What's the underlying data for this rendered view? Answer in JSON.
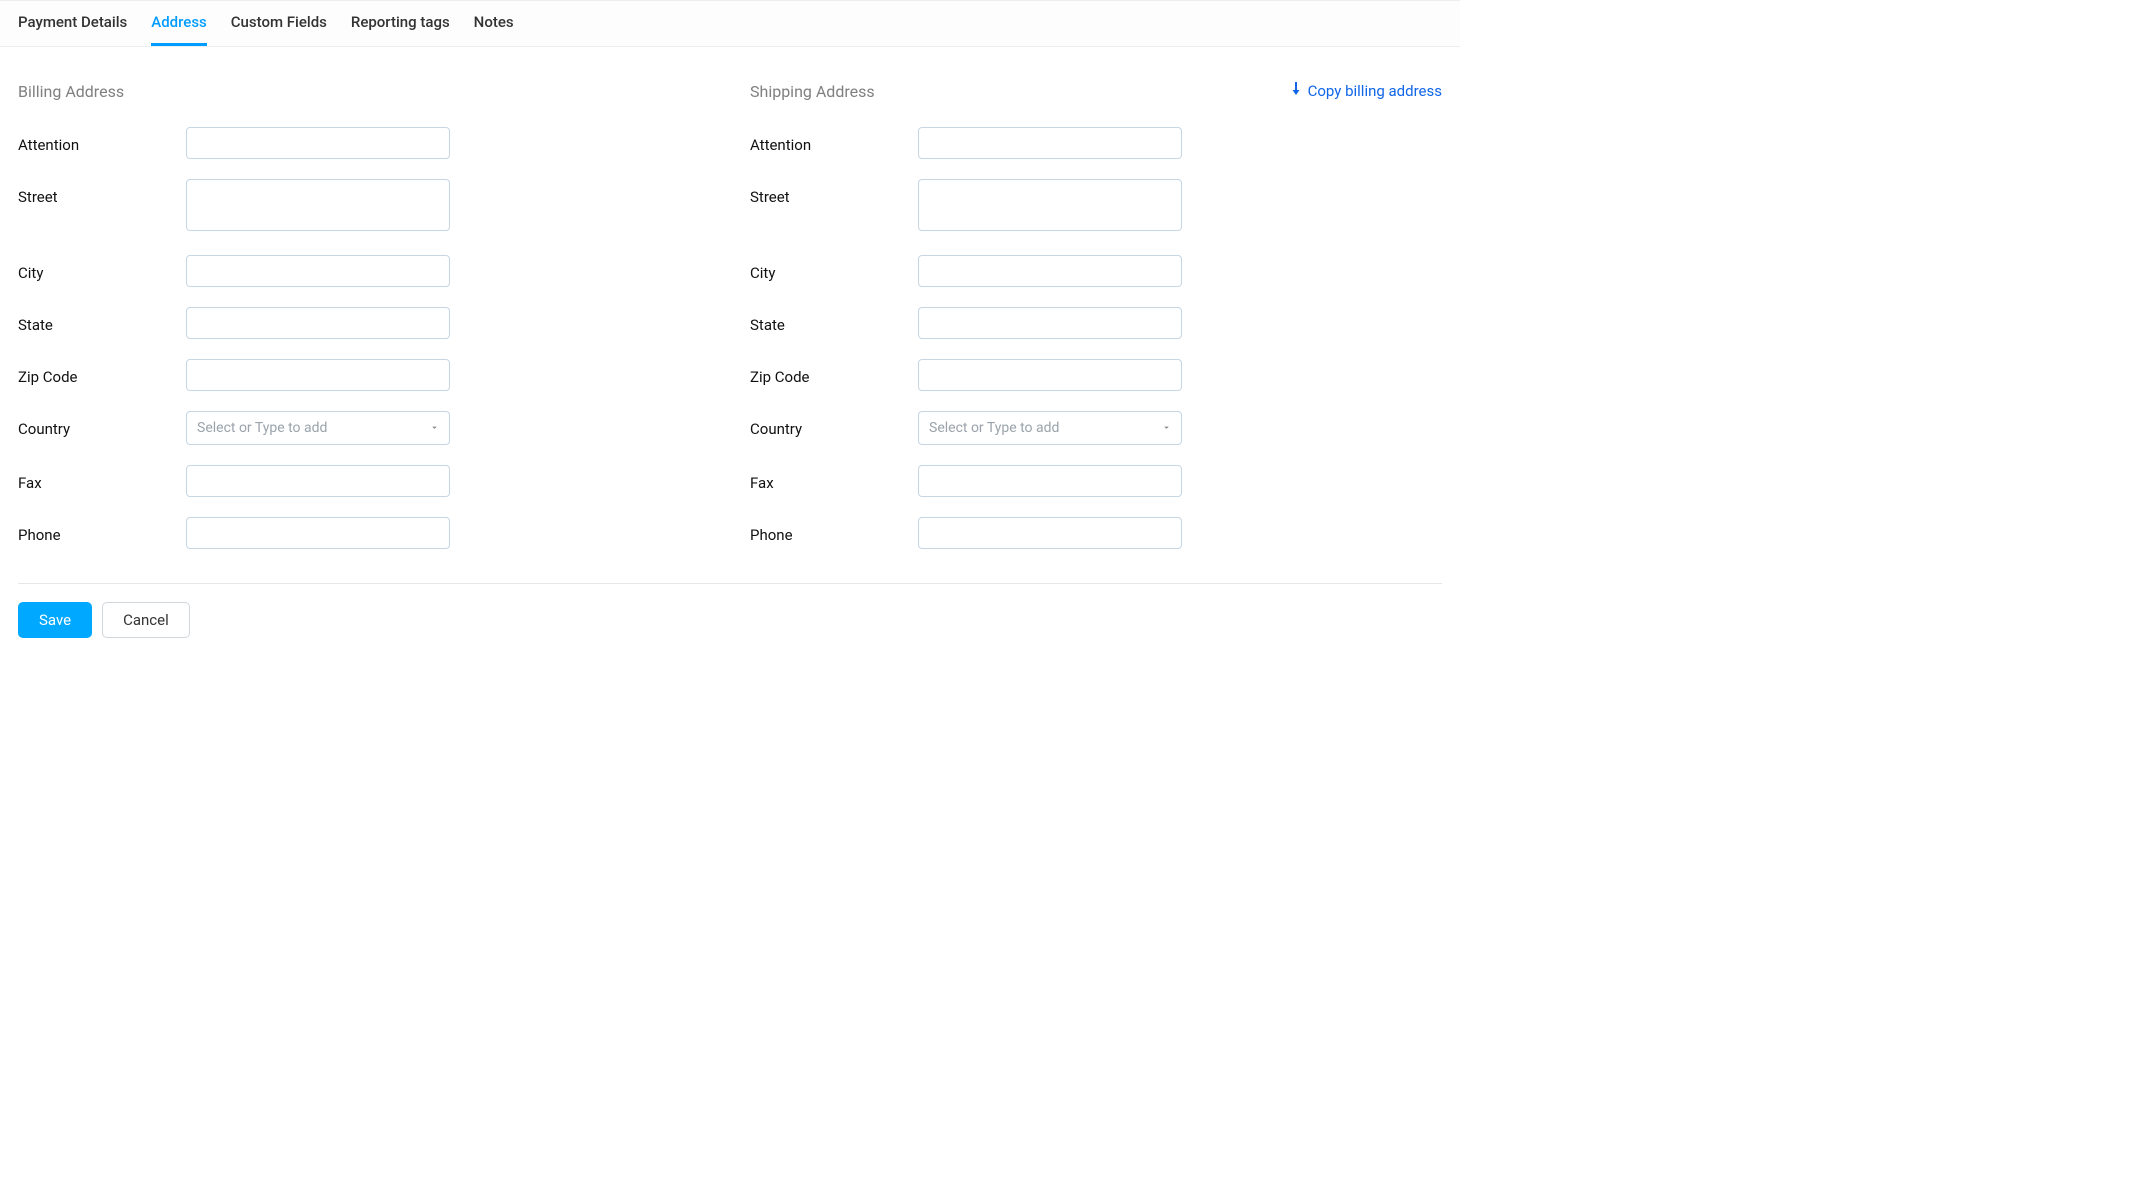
{
  "tabs": [
    {
      "label": "Payment Details",
      "active": false
    },
    {
      "label": "Address",
      "active": true
    },
    {
      "label": "Custom Fields",
      "active": false
    },
    {
      "label": "Reporting tags",
      "active": false
    },
    {
      "label": "Notes",
      "active": false
    }
  ],
  "billing": {
    "title": "Billing Address",
    "attention": {
      "label": "Attention",
      "value": ""
    },
    "street": {
      "label": "Street",
      "value": ""
    },
    "city": {
      "label": "City",
      "value": ""
    },
    "state": {
      "label": "State",
      "value": ""
    },
    "zip": {
      "label": "Zip Code",
      "value": ""
    },
    "country": {
      "label": "Country",
      "placeholder": "Select or Type to add",
      "value": ""
    },
    "fax": {
      "label": "Fax",
      "value": ""
    },
    "phone": {
      "label": "Phone",
      "value": ""
    }
  },
  "shipping": {
    "title": "Shipping Address",
    "copy_link": "Copy billing address",
    "attention": {
      "label": "Attention",
      "value": ""
    },
    "street": {
      "label": "Street",
      "value": ""
    },
    "city": {
      "label": "City",
      "value": ""
    },
    "state": {
      "label": "State",
      "value": ""
    },
    "zip": {
      "label": "Zip Code",
      "value": ""
    },
    "country": {
      "label": "Country",
      "placeholder": "Select or Type to add",
      "value": ""
    },
    "fax": {
      "label": "Fax",
      "value": ""
    },
    "phone": {
      "label": "Phone",
      "value": ""
    }
  },
  "actions": {
    "save": "Save",
    "cancel": "Cancel"
  }
}
